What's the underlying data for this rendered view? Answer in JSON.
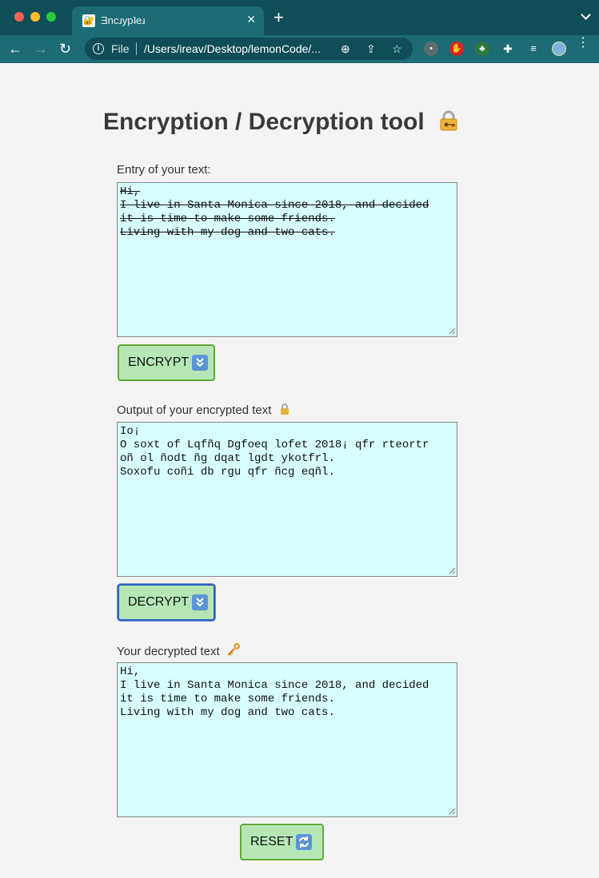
{
  "browser": {
    "tab_title": "Ǝncɹypʇeɹ",
    "address_prefix": "File",
    "url": "/Users/ireav/Desktop/lemonCode/..."
  },
  "page": {
    "title": "Encryption / Decryption tool",
    "title_icon": "lock-with-key-icon",
    "entry_label": "Entry of your text:",
    "entry_text": "Hi,\nI live in Santa Monica since 2018, and decided\nit is time to make some friends.\nLiving with my dog and two cats.",
    "encrypt_label": "ENCRYPT",
    "output_label": "Output of your encrypted text",
    "output_icon": "lock-icon",
    "output_text": "Io¡\nO soxt of Lqfñq Dgfoeq lofet 2018¡ qfr rteortr\noñ ol ñodt ñg dqat lgdt ykotfrl.\nSoxofu coñi db rgu qfr ñcg eqñl.",
    "decrypt_label": "DECRYPT",
    "decrypted_label": "Your decrypted text",
    "decrypted_icon": "key-icon",
    "decrypted_text": "Hi,\nI live in Santa Monica since 2018, and decided\nit is time to make some friends.\nLiving with my dog and two cats.",
    "reset_label": "RESET"
  },
  "colors": {
    "chrome_dark": "#0f4e57",
    "chrome_light": "#1d6b73",
    "textarea_bg": "#d7ffff",
    "button_bg": "#b6e6b6",
    "button_border": "#63a83a",
    "focus_border": "#2b5fc0"
  }
}
